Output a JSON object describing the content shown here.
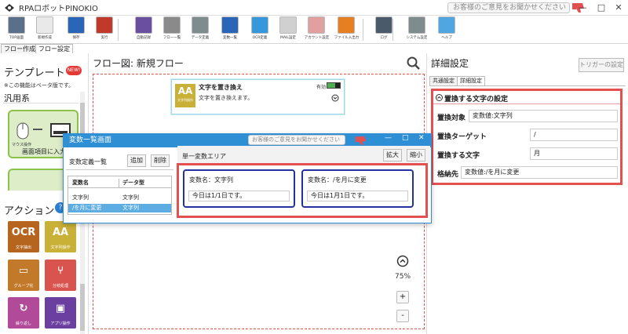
{
  "window": {
    "title": "RPAロボットPINOKIO",
    "feedback": "お客様のご意見をお聞かせください",
    "minimize": "—",
    "maximize": "□",
    "close": "✕"
  },
  "toolbar": {
    "items": [
      {
        "label": "TOP画面",
        "icon": "home-icon",
        "color": "#5a6f8a"
      },
      {
        "label": "新規作成",
        "icon": "new-file-icon",
        "color": "#e9e9e9"
      },
      {
        "label": "保存",
        "icon": "save-icon",
        "color": "#2a66b8"
      },
      {
        "label": "実行",
        "icon": "run-icon",
        "color": "#c0392b"
      },
      {
        "label": "自動記録",
        "icon": "record-icon",
        "color": "#6a4fa0"
      },
      {
        "label": "フロー一覧",
        "icon": "flow-list-icon",
        "color": "#8a8a8a"
      },
      {
        "label": "データ定義",
        "icon": "database-icon",
        "color": "#7f8c8d"
      },
      {
        "label": "変数一覧",
        "icon": "variable-list-icon",
        "color": "#2a66b8"
      },
      {
        "label": "OCR定義",
        "icon": "ocr-icon",
        "color": "#3498db"
      },
      {
        "label": "MAIL設定",
        "icon": "mail-icon",
        "color": "#d0d0d0"
      },
      {
        "label": "アカウント設定",
        "icon": "account-icon",
        "color": "#e0a0a0"
      },
      {
        "label": "ファイル入出力",
        "icon": "file-io-icon",
        "color": "#e67e22"
      },
      {
        "label": "ログ",
        "icon": "log-icon",
        "color": "#4a5a6a"
      },
      {
        "label": "システム設定",
        "icon": "gear-icon",
        "color": "#7f8c8d"
      },
      {
        "label": "ヘルプ",
        "icon": "help-icon",
        "color": "#4fa6e0"
      }
    ]
  },
  "main_tabs": [
    {
      "label": "フロー作成"
    },
    {
      "label": "フロー設定"
    }
  ],
  "left": {
    "template_title": "テンプレート",
    "new_badge": "NEW!",
    "beta_note": "※この機能はベータ版です。",
    "category": "汎用系",
    "template_card": {
      "label1": "マウス操作",
      "label2": "画面項目に入力"
    },
    "action_title": "アクション",
    "action_help": "?",
    "actions": [
      {
        "label": "文字抽出",
        "glyph": "OCR",
        "color": "#b5651d"
      },
      {
        "label": "文字列操作",
        "glyph": "AA",
        "color": "#c9b037"
      },
      {
        "label": "グループ化",
        "glyph": "▭",
        "color": "#c27a2a"
      },
      {
        "label": "分岐処理",
        "glyph": "⑂",
        "color": "#d9534f"
      },
      {
        "label": "繰り返し",
        "glyph": "↻",
        "color": "#b24a9a"
      },
      {
        "label": "アプリ操作",
        "glyph": "▣",
        "color": "#6a3fa0"
      }
    ]
  },
  "center": {
    "flow_title": "フロー図: 新規フロー",
    "node": {
      "glyph": "AA",
      "caption": "文字列操作",
      "title": "文字を置き換え",
      "desc": "文字を置き換えます。",
      "status": "有効"
    },
    "zoom": "75%",
    "zoom_in": "+",
    "zoom_out": "-"
  },
  "right": {
    "title": "詳細設定",
    "trigger_button": "トリガーの設定",
    "tabs": [
      {
        "label": "共通設定"
      },
      {
        "label": "詳細設定"
      }
    ],
    "section_title": "置換する文字の設定",
    "fields": [
      {
        "label": "置換対象",
        "value": "変数値:文字列"
      },
      {
        "label": "置換ターゲット",
        "value": "/"
      },
      {
        "label": "置換する文字",
        "value": "月"
      },
      {
        "label": "格納先",
        "value": "変数値:/を月に変更"
      }
    ]
  },
  "var_window": {
    "title": "変数一覧画面",
    "feedback": "お客様のご意見をお聞かせください",
    "minimize": "—",
    "maximize": "□",
    "close": "✕",
    "def_list_label": "変数定義一覧",
    "add_button": "追加",
    "delete_button": "削除",
    "columns": [
      "変数名",
      "データ型"
    ],
    "rows": [
      {
        "name": "文字列",
        "type": "文字列",
        "selected": false
      },
      {
        "name": "/を月に変更",
        "type": "文字列",
        "selected": true
      }
    ],
    "single_area_label": "単一変数エリア",
    "expand_button": "拡大",
    "shrink_button": "縮小",
    "cards": [
      {
        "name_prefix": "変数名：",
        "name": "文字列",
        "value": "今日は1/1日です。"
      },
      {
        "name_prefix": "変数名：",
        "name": "/を月に変更",
        "value": "今日は1月1日です。"
      }
    ]
  }
}
